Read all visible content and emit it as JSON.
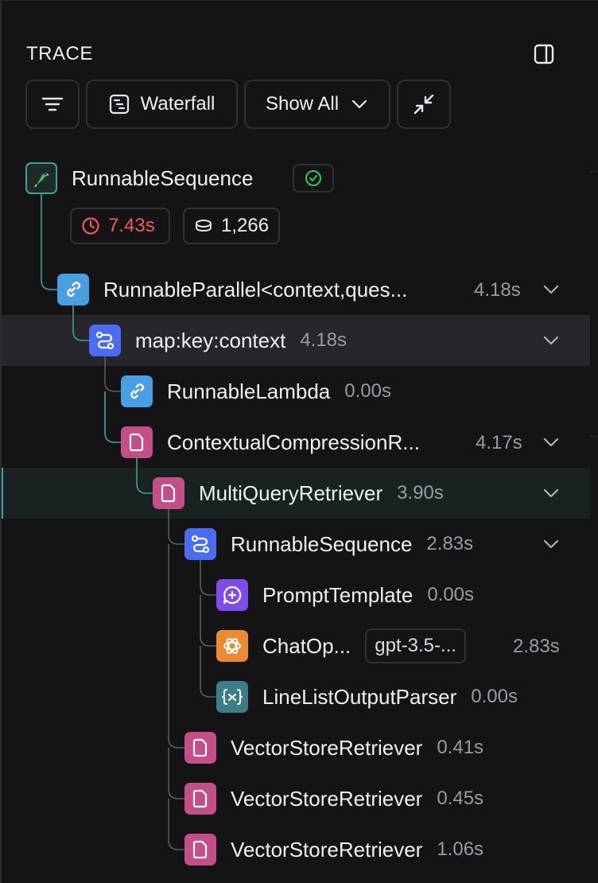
{
  "header": {
    "title": "TRACE"
  },
  "toolbar": {
    "waterfall_label": "Waterfall",
    "show_all_label": "Show All"
  },
  "root": {
    "name": "RunnableSequence",
    "latency": "7.43s",
    "tokens": "1,266",
    "colors": {
      "latency": "#f05a5a",
      "status": "#34c46a"
    }
  },
  "nodes": [
    {
      "name": "RunnableParallel<context,ques...",
      "time": "4.18s",
      "icon": "link-icon"
    },
    {
      "name": "map:key:context",
      "time": "4.18s",
      "icon": "route-icon"
    },
    {
      "name": "RunnableLambda",
      "time": "0.00s",
      "icon": "link-icon"
    },
    {
      "name": "ContextualCompressionR...",
      "time": "4.17s",
      "icon": "document-icon"
    },
    {
      "name": "MultiQueryRetriever",
      "time": "3.90s",
      "icon": "document-icon"
    },
    {
      "name": "RunnableSequence",
      "time": "2.83s",
      "icon": "route-icon"
    },
    {
      "name": "PromptTemplate",
      "time": "0.00s",
      "icon": "chat-plus-icon"
    },
    {
      "name": "ChatOp...",
      "model": "gpt-3.5-...",
      "time": "2.83s",
      "icon": "openai-icon"
    },
    {
      "name": "LineListOutputParser",
      "time": "0.00s",
      "icon": "variable-icon"
    },
    {
      "name": "VectorStoreRetriever",
      "time": "0.41s",
      "icon": "document-icon"
    },
    {
      "name": "VectorStoreRetriever",
      "time": "0.45s",
      "icon": "document-icon"
    },
    {
      "name": "VectorStoreRetriever",
      "time": "1.06s",
      "icon": "document-icon"
    }
  ]
}
